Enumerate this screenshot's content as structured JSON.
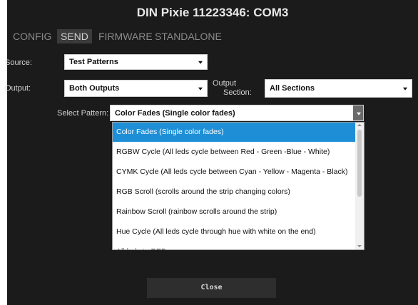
{
  "window": {
    "title": "DIN Pixie 11223346: COM3"
  },
  "tabs": [
    {
      "label": "CONFIG",
      "active": false
    },
    {
      "label": "SEND",
      "active": true
    },
    {
      "label": "FIRMWARE",
      "active": false
    },
    {
      "label": "STANDALONE",
      "active": false
    }
  ],
  "source": {
    "label": "Source:",
    "value": "Test Patterns"
  },
  "output": {
    "label": "Output:",
    "value": "Both Outputs"
  },
  "output_section": {
    "label_line1": "Output",
    "label_line2": "Section:",
    "value": "All Sections"
  },
  "pattern": {
    "label": "Select Pattern:",
    "value": "Color Fades (Single color fades)",
    "options": [
      "Color Fades (Single color fades)",
      "RGBW Cycle (All leds cycle between Red - Green -Blue - White)",
      "CYMK Cycle (All leds cycle between Cyan - Yellow - Magenta - Black)",
      "RGB Scroll (scrolls around the strip changing colors)",
      "Rainbow Scroll (rainbow scrolls around the strip)",
      "Hue Cycle (All leds cycle through hue with white on the end)",
      "All leds to RED"
    ]
  },
  "buttons": {
    "close": "Close"
  },
  "colors": {
    "background": "#1b1b1b",
    "accent": "#1e8fd6"
  }
}
